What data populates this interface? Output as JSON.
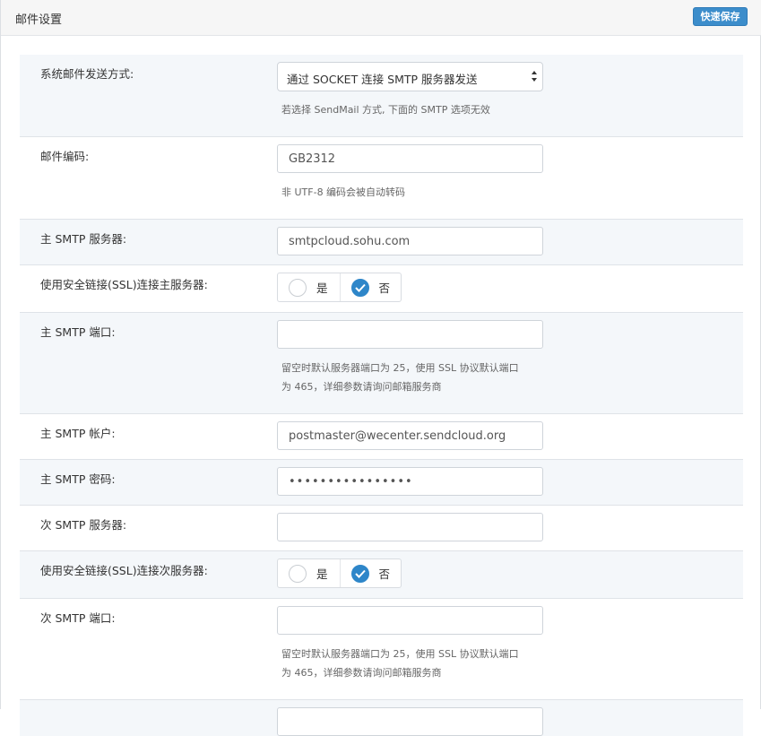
{
  "header": {
    "title": "邮件设置",
    "save_label": "快速保存"
  },
  "colors": {
    "accent": "#3c8dcb",
    "checked": "#2e86c9",
    "row_alt": "#f4f7fa"
  },
  "rows": {
    "send_method": {
      "label": "系统邮件发送方式:",
      "selected": "通过 SOCKET 连接 SMTP 服务器发送",
      "hint": "若选择 SendMail 方式, 下面的 SMTP 选项无效"
    },
    "encoding": {
      "label": "邮件编码:",
      "value": "GB2312",
      "hint": "非 UTF-8 编码会被自动转码"
    },
    "primary_server": {
      "label": "主 SMTP 服务器:",
      "value": "smtpcloud.sohu.com"
    },
    "primary_ssl": {
      "label": "使用安全链接(SSL)连接主服务器:",
      "yes": "是",
      "no": "否",
      "selected": "否"
    },
    "primary_port": {
      "label": "主 SMTP 端口:",
      "value": "",
      "hint_line1": "留空时默认服务器端口为 25，使用 SSL 协议默认端口",
      "hint_line2": "为 465，详细参数请询问邮箱服务商"
    },
    "primary_account": {
      "label": "主 SMTP 帐户:",
      "value": "postmaster@wecenter.sendcloud.org"
    },
    "primary_password": {
      "label": "主 SMTP 密码:",
      "value": "••••••••••••••••"
    },
    "secondary_server": {
      "label": "次 SMTP 服务器:",
      "value": ""
    },
    "secondary_ssl": {
      "label": "使用安全链接(SSL)连接次服务器:",
      "yes": "是",
      "no": "否",
      "selected": "否"
    },
    "secondary_port": {
      "label": "次 SMTP 端口:",
      "value": "",
      "hint_line1": "留空时默认服务器端口为 25，使用 SSL 协议默认端口",
      "hint_line2": "为 465，详细参数请询问邮箱服务商"
    }
  }
}
